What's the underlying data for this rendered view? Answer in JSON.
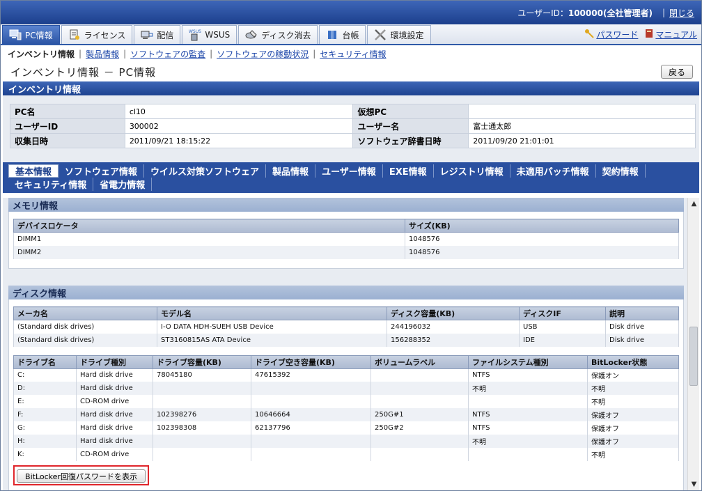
{
  "topbar": {
    "user_label": "ユーザーID：",
    "user_value": "100000(全社管理者)",
    "close": "閉じる"
  },
  "tabs": [
    {
      "label": "PC情報",
      "icon": "pc-icon",
      "active": true
    },
    {
      "label": "ライセンス",
      "icon": "license-icon",
      "active": false
    },
    {
      "label": "配信",
      "icon": "delivery-icon",
      "active": false
    },
    {
      "label": "WSUS",
      "icon": "wsus-icon",
      "active": false
    },
    {
      "label": "ディスク消去",
      "icon": "disk-erase-icon",
      "active": false
    },
    {
      "label": "台帳",
      "icon": "ledger-icon",
      "active": false
    },
    {
      "label": "環境設定",
      "icon": "settings-tools-icon",
      "active": false
    }
  ],
  "top_links": {
    "password": "パスワード",
    "manual": "マニュアル"
  },
  "subnav": {
    "current": "インベントリ情報",
    "links": [
      "製品情報",
      "ソフトウェアの監査",
      "ソフトウェアの稼動状況",
      "セキュリティ情報"
    ]
  },
  "page_title": "インベントリ情報 － PC情報",
  "back_button": "戻る",
  "inventory": {
    "header": "インベントリ情報",
    "rows": [
      [
        "PC名",
        "cl10",
        "仮想PC",
        ""
      ],
      [
        "ユーザーID",
        "300002",
        "ユーザー名",
        "富士通太郎"
      ],
      [
        "収集日時",
        "2011/09/21 18:15:22",
        "ソフトウェア辞書日時",
        "2011/09/20 21:01:01"
      ]
    ]
  },
  "detail_tabs": [
    "基本情報",
    "ソフトウェア情報",
    "ウイルス対策ソフトウェア",
    "製品情報",
    "ユーザー情報",
    "EXE情報",
    "レジストリ情報",
    "未適用パッチ情報",
    "契約情報",
    "セキュリティ情報",
    "省電力情報"
  ],
  "memory": {
    "header": "メモリ情報",
    "columns": [
      "デバイスロケータ",
      "サイズ(KB)"
    ],
    "rows": [
      [
        "DIMM1",
        "1048576"
      ],
      [
        "DIMM2",
        "1048576"
      ]
    ]
  },
  "disk": {
    "header": "ディスク情報",
    "columns": [
      "メーカ名",
      "モデル名",
      "ディスク容量(KB)",
      "ディスクIF",
      "説明"
    ],
    "rows": [
      [
        "(Standard disk drives)",
        "I-O DATA HDH-SUEH USB Device",
        "244196032",
        "USB",
        "Disk drive"
      ],
      [
        "(Standard disk drives)",
        "ST3160815AS ATA Device",
        "156288352",
        "IDE",
        "Disk drive"
      ]
    ]
  },
  "drives": {
    "columns": [
      "ドライブ名",
      "ドライブ種別",
      "ドライブ容量(KB)",
      "ドライブ空き容量(KB)",
      "ボリュームラベル",
      "ファイルシステム種別",
      "BitLocker状態"
    ],
    "rows": [
      [
        "C:",
        "Hard disk drive",
        "78045180",
        "47615392",
        "",
        "NTFS",
        "保護オン"
      ],
      [
        "D:",
        "Hard disk drive",
        "",
        "",
        "",
        "不明",
        "不明"
      ],
      [
        "E:",
        "CD-ROM drive",
        "",
        "",
        "",
        "",
        "不明"
      ],
      [
        "F:",
        "Hard disk drive",
        "102398276",
        "10646664",
        "250G#1",
        "NTFS",
        "保護オフ"
      ],
      [
        "G:",
        "Hard disk drive",
        "102398308",
        "62137796",
        "250G#2",
        "NTFS",
        "保護オフ"
      ],
      [
        "H:",
        "Hard disk drive",
        "",
        "",
        "",
        "不明",
        "保護オフ"
      ],
      [
        "K:",
        "CD-ROM drive",
        "",
        "",
        "",
        "",
        "不明"
      ]
    ]
  },
  "bitlocker_button": "BitLocker回復パスワードを表示",
  "colors": {
    "header_blue": "#1e4390",
    "highlight_red": "#e0262b",
    "link_blue": "#1a44a8"
  }
}
